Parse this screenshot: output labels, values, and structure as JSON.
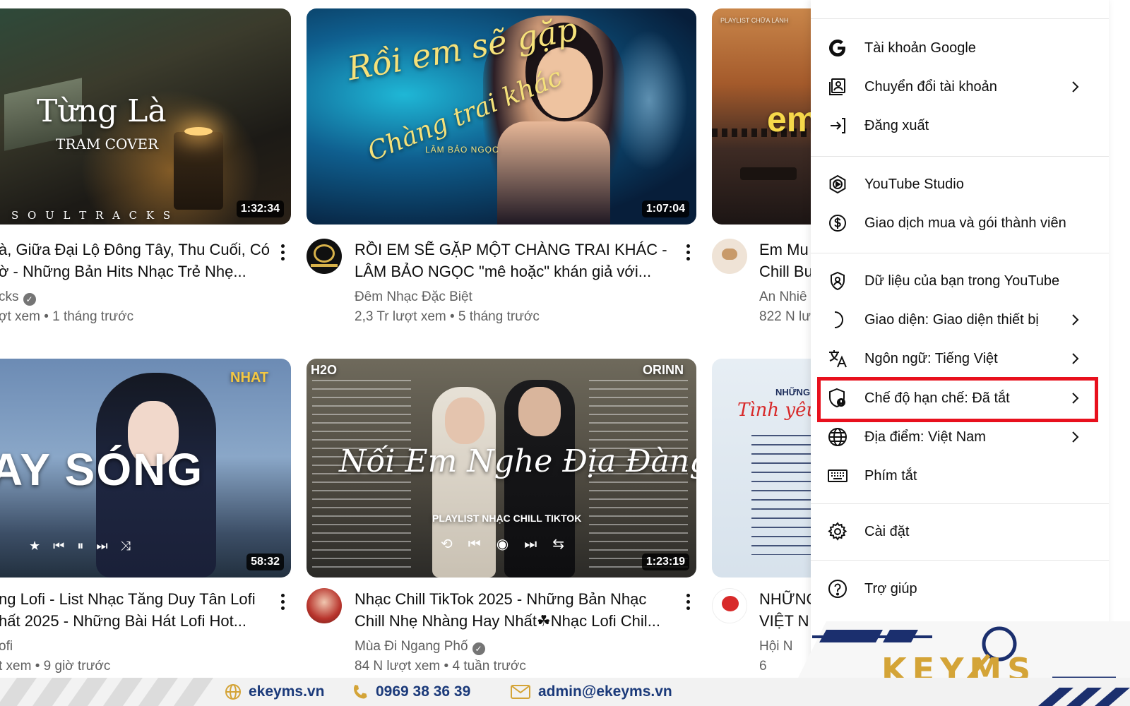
{
  "videos": [
    {
      "thumb_text": "Từng Là",
      "thumb_sub": "TRAM COVER",
      "thumb_tag": "S O U L   T R A C K S",
      "duration": "1:32:34",
      "title_line1": "à, Giữa Đại Lộ Đông Tây, Thu Cuối, Có",
      "title_line2": "ờ - Những Bản Hits Nhạc Trẻ Nhẹ...",
      "channel": "cks",
      "meta": "ợt xem • 1 tháng trước"
    },
    {
      "thumb_text": "Rồi em sẽ gặp",
      "thumb_sub": "Chàng trai khác",
      "thumb_tag": "LÂM BẢO NGỌC",
      "duration": "1:07:04",
      "title_line1": "RỒI EM SẼ GẶP MỘT CHÀNG TRAI KHÁC -",
      "title_line2": "LÂM BẢO NGỌC \"mê hoặc\" khán giả với...",
      "channel": "Đêm Nhạc Đặc Biệt",
      "meta": "2,3 Tr lượt xem • 5 tháng trước"
    },
    {
      "thumb_text": "em",
      "thumb_sub": "PLAYLIST CHỮA LÀNH",
      "title_line1": "Em Mu",
      "title_line2": "Chill Bu",
      "channel": "An Nhiê",
      "meta": "822 N lư"
    },
    {
      "thumb_text": "AY SÓNG",
      "thumb_sub": "NHAT",
      "duration": "58:32",
      "title_line1": "ng Lofi - List Nhạc Tăng Duy Tân Lofi",
      "title_line2": "hất 2025 - Những Bài Hát Lofi Hot...",
      "channel": "ofi",
      "meta": "t xem • 9 giờ trước"
    },
    {
      "thumb_text": "Nối Em Nghe Địa Đàng",
      "thumb_sub": "PLAYLIST NHẠC CHILL TIKTOK",
      "thumb_tag": "H2O",
      "thumb_tag2": "ORINN",
      "duration": "1:23:19",
      "title_line1": "Nhạc Chill TikTok 2025 - Những Bản Nhạc",
      "title_line2": "Chill Nhẹ Nhàng Hay Nhất☘Nhạc Lofi Chil...",
      "channel": "Mùa Đi Ngang Phố",
      "meta": "84 N lượt xem • 4 tuần trước"
    },
    {
      "thumb_text": "Tình yêu qu",
      "thumb_sub": "NHỮNG",
      "title_line1": "NHỮNG",
      "title_line2": "VIỆT N",
      "channel": "Hội N",
      "meta": "6"
    }
  ],
  "menu": {
    "items": [
      {
        "label": "Tài khoản Google",
        "icon": "google-icon"
      },
      {
        "label": "Chuyển đổi tài khoản",
        "icon": "switch-account-icon"
      },
      {
        "label": "Đăng xuất",
        "icon": "sign-out-icon"
      },
      {
        "label": "YouTube Studio",
        "icon": "youtube-studio-icon"
      },
      {
        "label": "Giao dịch mua và gói thành viên",
        "icon": "purchases-icon"
      },
      {
        "label": "Dữ liệu của bạn trong YouTube",
        "icon": "your-data-icon"
      },
      {
        "label": "Giao diện: Giao diện thiết bị",
        "icon": "appearance-moon-icon"
      },
      {
        "label": "Ngôn ngữ: Tiếng Việt",
        "icon": "language-icon"
      },
      {
        "label": "Chế độ hạn chế: Đã tắt",
        "icon": "restricted-mode-icon"
      },
      {
        "label": "Địa điểm: Việt Nam",
        "icon": "globe-icon"
      },
      {
        "label": "Phím tắt",
        "icon": "keyboard-icon"
      },
      {
        "label": "Cài đặt",
        "icon": "settings-gear-icon"
      },
      {
        "label": "Trợ giúp",
        "icon": "help-icon"
      }
    ]
  },
  "footer": {
    "website": "ekeyms.vn",
    "phone": "0969 38 36 39",
    "email": "admin@ekeyms.vn",
    "logo": "KEYMS"
  },
  "colors": {
    "highlight": "#e8101d",
    "footer_text": "#1b3a7a",
    "logo_gold": "#d4a437",
    "logo_navy": "#1b2f6e"
  }
}
